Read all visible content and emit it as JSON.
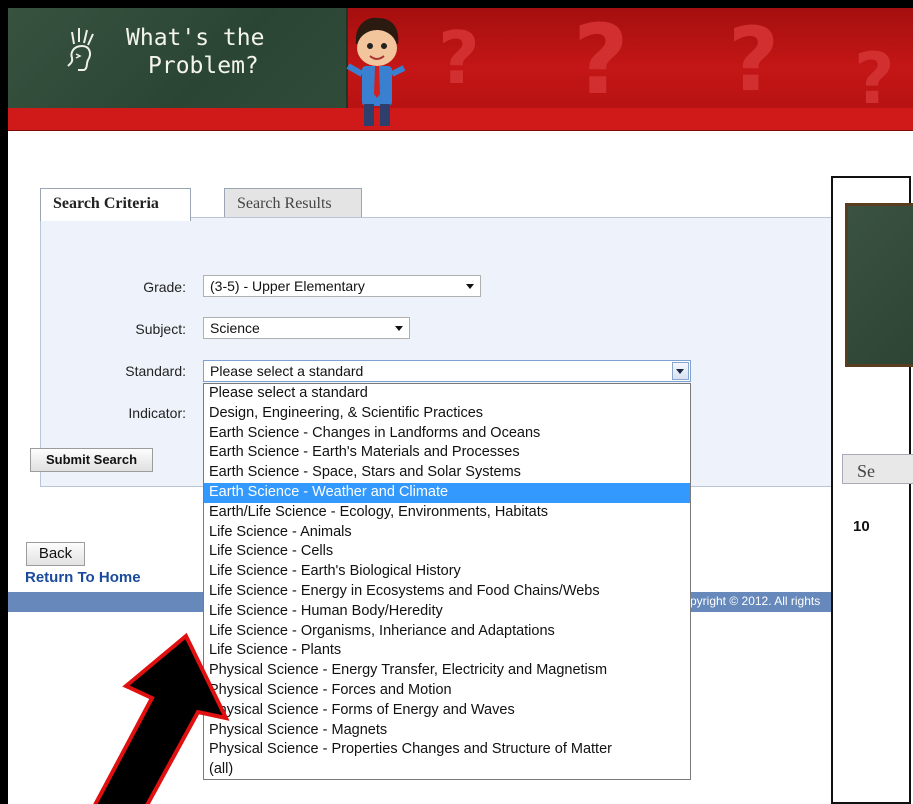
{
  "banner": {
    "title_line1": "What's the",
    "title_line2": "Problem?"
  },
  "tabs": [
    {
      "label": "Search Criteria",
      "active": true
    },
    {
      "label": "Search Results",
      "active": false
    }
  ],
  "form": {
    "grade_label": "Grade:",
    "grade_value": "(3-5) - Upper Elementary",
    "subject_label": "Subject:",
    "subject_value": "Science",
    "standard_label": "Standard:",
    "standard_value": "Please select a standard",
    "indicator_label": "Indicator:",
    "submit_label": "Submit Search"
  },
  "standard_options": [
    "Please select a standard",
    "Design, Engineering, & Scientific Practices",
    "Earth Science - Changes in Landforms and Oceans",
    "Earth Science - Earth's Materials and Processes",
    "Earth Science - Space, Stars and Solar Systems",
    "Earth Science - Weather and Climate",
    "Earth/Life Science - Ecology, Environments, Habitats",
    "Life Science - Animals",
    "Life Science - Cells",
    "Life Science - Earth's Biological History",
    "Life Science - Energy in Ecosystems and Food Chains/Webs",
    "Life Science - Human Body/Heredity",
    "Life Science - Organisms, Inheriance and Adaptations",
    "Life Science - Plants",
    "Physical Science - Energy Transfer, Electricity and Magnetism",
    "Physical Science - Forces and Motion",
    "Physical Science - Forms of Energy and Waves",
    "Physical Science - Magnets",
    "Physical Science - Properties Changes and Structure of Matter",
    "(all)"
  ],
  "highlighted_option_index": 5,
  "nav": {
    "back_label": "Back",
    "home_label": "Return To Home"
  },
  "footer": {
    "copyright": "pyright © 2012. All rights"
  },
  "right_window": {
    "tab_label": "Se",
    "count": "10"
  },
  "colors": {
    "banner_red": "#c01818",
    "chalkboard": "#2f4a38",
    "highlight": "#3399ff",
    "footer_bar": "#6688bb",
    "link": "#1a4a9a"
  }
}
